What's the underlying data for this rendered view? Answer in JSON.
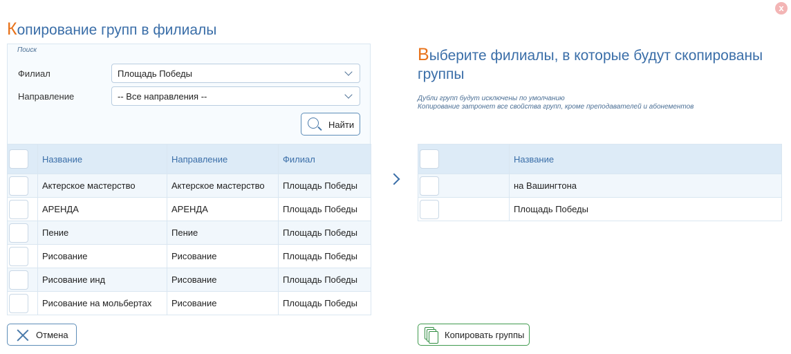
{
  "dialog": {
    "close_label": "x"
  },
  "left": {
    "title_first": "К",
    "title_rest": "опирование групп в филиалы",
    "search": {
      "caption": "Поиск",
      "branch_label": "Филиал",
      "branch_value": "Площадь Победы",
      "direction_label": "Направление",
      "direction_value": "-- Все направления --",
      "find_label": "Найти"
    },
    "table": {
      "columns": [
        "Название",
        "Направление",
        "Филиал"
      ],
      "rows": [
        [
          "Актерское мастерство",
          "Актерское мастерство",
          "Площадь Победы"
        ],
        [
          "АРЕНДА",
          "АРЕНДА",
          "Площадь Победы"
        ],
        [
          "Пение",
          "Пение",
          "Площадь Победы"
        ],
        [
          "Рисование",
          "Рисование",
          "Площадь Победы"
        ],
        [
          "Рисование инд",
          "Рисование",
          "Площадь Победы"
        ],
        [
          "Рисование на мольбертах",
          "Рисование",
          "Площадь Победы"
        ]
      ]
    },
    "cancel_label": "Отмена"
  },
  "right": {
    "title_first": "В",
    "title_rest": "ыберите филиалы, в которые будут скопированы группы",
    "hint_line1": "Дубли групп будут исключены по умолчанию",
    "hint_line2": "Копирование затронет все свойства групп, кроме преподавателей и абонементов",
    "table": {
      "columns": [
        "Название"
      ],
      "rows": [
        [
          "на Вашингтона"
        ],
        [
          "Площадь Победы"
        ]
      ]
    },
    "copy_label": "Копировать группы"
  },
  "colors": {
    "accent_orange": "#e8721a",
    "title_blue": "#3a6ea8",
    "header_bg": "#ddebf7",
    "copy_green": "#3f9a4e"
  },
  "icons": {
    "close": "close-icon",
    "search": "search-icon",
    "move": "chevron-right-icon",
    "cancel": "x-icon",
    "copy": "copy-documents-icon"
  }
}
